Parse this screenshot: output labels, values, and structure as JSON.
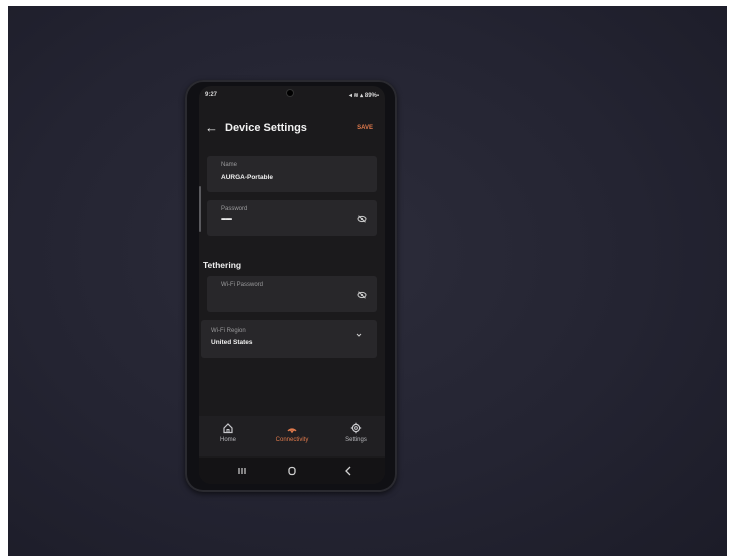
{
  "status_bar": {
    "time": "9:27",
    "indicators": "◂ ≋ ▴ 89%▪"
  },
  "header": {
    "title": "Device Settings",
    "save_label": "SAVE",
    "back_icon": "arrow-left-icon"
  },
  "fields": {
    "name": {
      "label": "Name",
      "value": "AURGA-Portable"
    },
    "password": {
      "label": "Password",
      "value": "••••••••",
      "icon": "eye-off-icon"
    }
  },
  "tethering": {
    "title": "Tethering",
    "wifi_password": {
      "label": "Wi-Fi Password",
      "icon": "eye-off-icon"
    },
    "wifi_region": {
      "label": "Wi-Fi Region",
      "value": "United States",
      "icon": "chevron-down-icon"
    }
  },
  "bottom_nav": {
    "items": [
      {
        "label": "Home",
        "icon": "home-icon",
        "active": false
      },
      {
        "label": "Connectivity",
        "icon": "connectivity-icon",
        "active": true
      },
      {
        "label": "Settings",
        "icon": "gear-icon",
        "active": false
      }
    ]
  },
  "colors": {
    "accent": "#e07a4c",
    "screen_bg": "#1b1a1c",
    "card_bg": "#28272a",
    "backdrop": "#242432"
  }
}
